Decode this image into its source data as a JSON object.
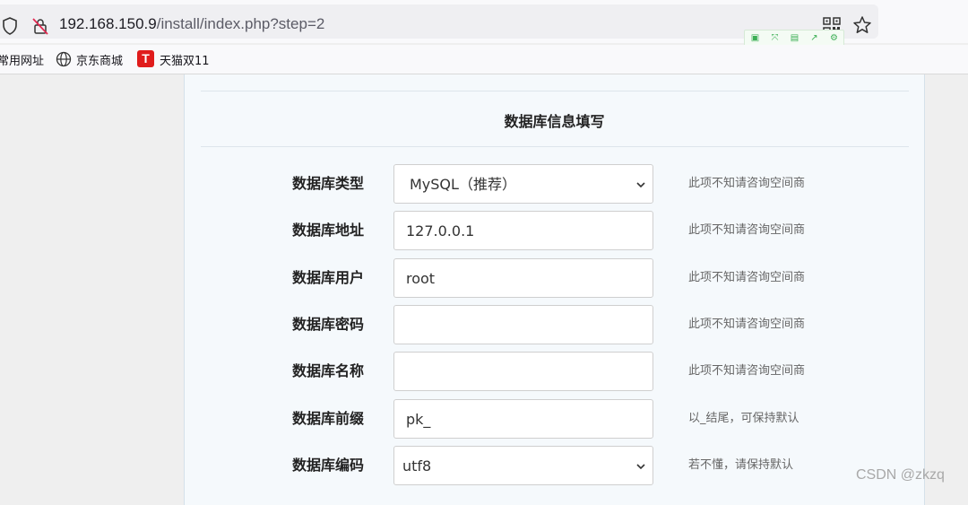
{
  "browser": {
    "url_host": "192.168.150.9",
    "url_path": "/install/index.php?step=2",
    "bookmarks": [
      "常用网址",
      "京东商城",
      "天猫双11"
    ],
    "tmall_letter": "T"
  },
  "form": {
    "title": "数据库信息填写",
    "rows": [
      {
        "label": "数据库类型",
        "type": "select",
        "value": "MySQL（推荐）",
        "hint": "此项不知请咨询空间商"
      },
      {
        "label": "数据库地址",
        "type": "input",
        "value": "127.0.0.1",
        "hint": "此项不知请咨询空间商"
      },
      {
        "label": "数据库用户",
        "type": "input",
        "value": "root",
        "hint": "此项不知请咨询空间商"
      },
      {
        "label": "数据库密码",
        "type": "input",
        "value": "",
        "hint": "此项不知请咨询空间商"
      },
      {
        "label": "数据库名称",
        "type": "input",
        "value": "",
        "hint": "此项不知请咨询空间商"
      },
      {
        "label": "数据库前缀",
        "type": "input",
        "value": "pk_",
        "hint": "以_结尾，可保持默认"
      },
      {
        "label": "数据库编码",
        "type": "select",
        "value": "utf8",
        "hint": "若不懂，请保持默认"
      }
    ]
  },
  "watermark": "CSDN @zkzq"
}
